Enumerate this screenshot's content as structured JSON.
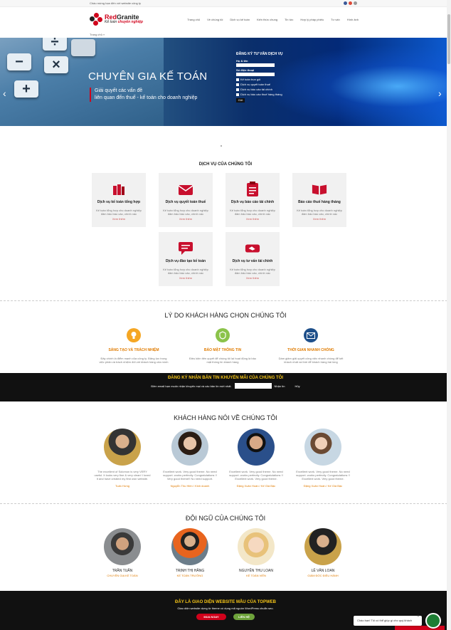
{
  "topbar": {
    "welcome": "Chào mừng bạn đến với website công ty"
  },
  "logo": {
    "brand_red": "Red",
    "brand_dark": "Granite",
    "tag_a": "Kế toán",
    "tag_b": "chuyên nghiệp"
  },
  "nav": [
    "Trang chủ",
    "Về chúng tôi",
    "Dịch vụ kế toán",
    "Kiến thức chung",
    "Tin tức",
    "Hợp lý pháp phiếu",
    "Tư vấn",
    "Hình ảnh"
  ],
  "breadcrumb": "Trang chủ »",
  "hero": {
    "title": "CHUYÊN GIA KẾ TOÁN",
    "sub1": "Giải quyết các vấn đề",
    "sub2": "liên quan đến thuế - kế toán cho doanh nghiệp"
  },
  "form": {
    "title": "ĐĂNG KÝ TƯ VẤN DỊCH VỤ",
    "name_label": "Họ & tên",
    "phone_label": "Số điện thoại",
    "options": [
      "Kế toán trọn gói",
      "Dịch vụ quyết toán thuế",
      "Dịch vụ báo cáo tài chính",
      "Dịch vụ báo cáo thuế hàng tháng"
    ],
    "send": "Gửi"
  },
  "services": {
    "heading": "DỊCH VỤ CỦA CHÚNG TÔI",
    "items": [
      {
        "title": "Dịch vụ kế toán tổng hợp",
        "desc": "Kế toán tổng hợp cho doanh nghiệp đảm bảo báo cáo, chính xác",
        "more": "Xem thêm"
      },
      {
        "title": "Dịch vụ quyết toán thuế",
        "desc": "Kế toán tổng hợp cho doanh nghiệp đảm bảo báo cáo, chính xác",
        "more": "Xem thêm"
      },
      {
        "title": "Dịch vụ báo cáo tài chính",
        "desc": "Kế toán tổng hợp cho doanh nghiệp đảm bảo báo cáo, chính xác",
        "more": "Xem thêm"
      },
      {
        "title": "Báo cáo thuế hàng tháng",
        "desc": "Kế toán tổng hợp cho doanh nghiệp đảm bảo báo cáo, chính xác",
        "more": "Xem thêm"
      },
      {
        "title": "Dịch vụ đào tạo kế toán",
        "desc": "Kế toán tổng hợp cho doanh nghiệp đảm bảo báo cáo, chính xác",
        "more": "Xem thêm"
      },
      {
        "title": "Dịch vụ tư vấn tài chính",
        "desc": "Kế toán tổng hợp cho doanh nghiệp đảm bảo báo cáo, chính xác",
        "more": "Xem thêm"
      }
    ]
  },
  "reasons": {
    "heading": "LÝ DO KHÁCH HÀNG CHỌN CHÚNG TÔI",
    "items": [
      {
        "title": "SÁNG TẠO VÀ TRÁCH NHIỆM",
        "desc": "Đây chính là điểm mạnh của công ty. Đăng lực trong việc phân và trách nhiệm đối với khách hàng của mình"
      },
      {
        "title": "BẢO MẬT THÔNG TIN",
        "desc": "Điều kiện tiên quyết để chúng tôi lại hoạt động là bảo mật thông tin khách hàng"
      },
      {
        "title": "THỜI GIAN NHANH CHÓNG",
        "desc": "Dám giảm giải quyết công việc nhanh chóng để kết khách nhất và thời để khách hàng hài lòng"
      }
    ]
  },
  "newsletter": {
    "title": "ĐĂNG KÝ NHẬN BẢN TIN KHUYẾN MÃI CỦA CHÚNG TÔI",
    "prompt": "Điền email bạn muốn nhận khuyến mại và các bản tin mới nhất.",
    "button": "Nhận tin",
    "cancel": "Hủy"
  },
  "testimonials": {
    "heading": "KHÁCH HÀNG NÓI VỀ CHÚNG TÔI",
    "items": [
      {
        "quote": "The excellent of Solomon is very VERY useful. It looks very fine & very clean! I loved it and have created my first own website.",
        "name": "Tuấn Hưng"
      },
      {
        "quote": "Excellent work. Very good theme. No need support. works perfectly. Congratulations !! Very good theme!! No need support.",
        "name": "Nguyễn Thu Hiền / Kinh doanh"
      },
      {
        "quote": "Excellent work. Very good theme. No need support. works perfectly. Congratulations !! Excellent work. Very good theme.",
        "name": "Đặng Xuân Hoàn / Kế Giá Bậc"
      },
      {
        "quote": "Excellent work. Very good theme. No need support. works perfectly. Congratulations !! Excellent work. Very good theme.",
        "name": "Đặng Xuân Hoàn / Kế Giá Bậc"
      }
    ]
  },
  "team": {
    "heading": "ĐỘI NGŨ CỦA CHÚNG TÔI",
    "items": [
      {
        "name": "TRẦN TUẤN",
        "role": "CHUYÊN GIA KẾ TOÁN"
      },
      {
        "name": "TRỊNH THỊ HẰNG",
        "role": "KẾ TOÁN TRƯỞNG"
      },
      {
        "name": "NGUYỄN THU LOAN",
        "role": "KẾ TOÁN VIÊN"
      },
      {
        "name": "LÊ VĂN LOAN",
        "role": "GIÁM ĐỐC ĐIỀU HÀNH"
      }
    ]
  },
  "footer": {
    "title": "ĐÂY LÀ GIAO DIỆN WEBSITE MẪU CỦA TOPWEB",
    "desc": "Giao diện website dựng từ theme có dụng mã nguồn WordPress chuẩn seo.",
    "btn_primary": "MUA NGAY",
    "btn_secondary": "LIÊN HỆ"
  },
  "chat": {
    "label": "Chào bạn! Tôi có thể giúp gì cho quý khách"
  },
  "colors": {
    "brand_red": "#d0021b",
    "accent_orange": "#e07b00",
    "footer_bg": "#111111",
    "chat_green": "#1e7e34"
  }
}
